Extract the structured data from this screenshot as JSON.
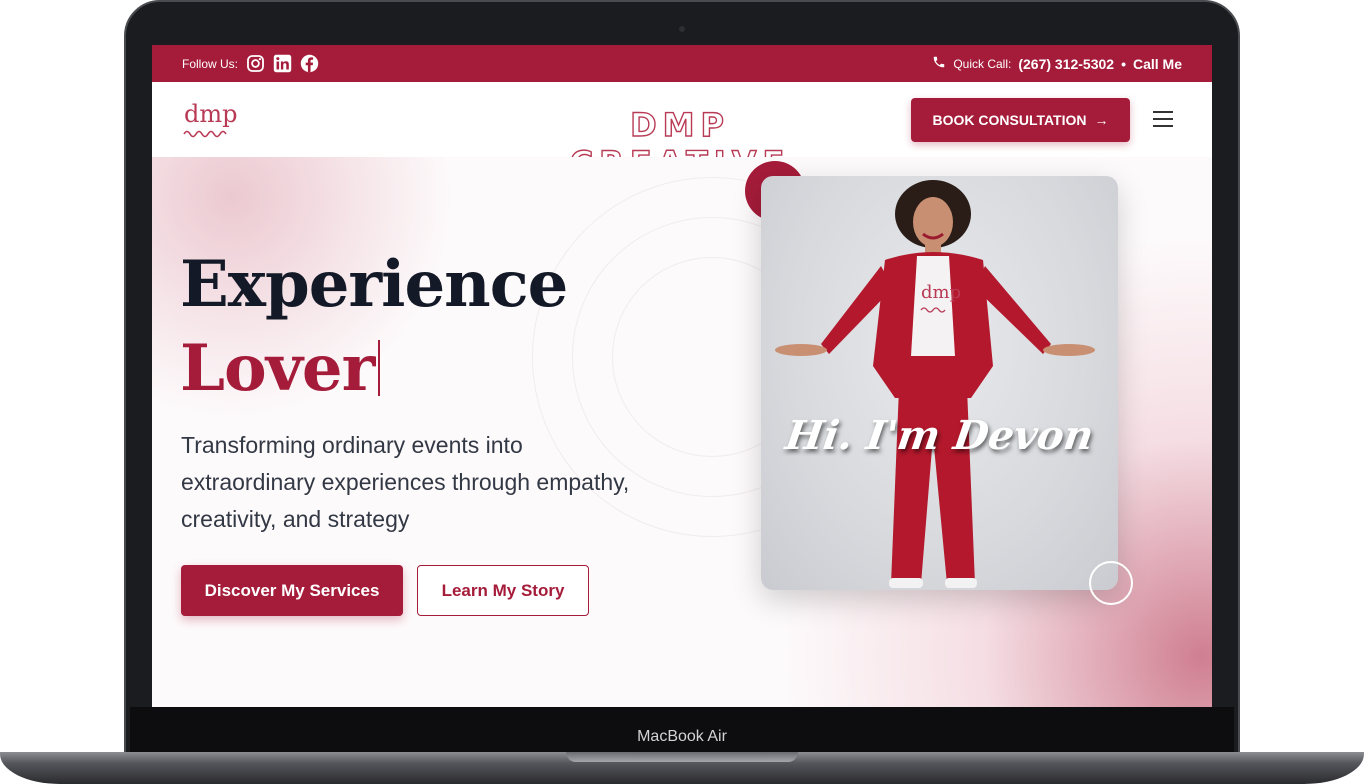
{
  "topbar": {
    "follow_label": "Follow Us:",
    "social_icons": [
      "instagram-icon",
      "linkedin-icon",
      "facebook-icon"
    ],
    "quick_call_label": "Quick Call:",
    "phone": "(267) 312-5302",
    "separator": "•",
    "call_me": "Call Me"
  },
  "header": {
    "logo_text": "dmp",
    "brand": "DMP CREATIVE",
    "book_label": "BOOK CONSULTATION",
    "book_arrow": "→"
  },
  "hero": {
    "headline_1": "Experience",
    "headline_2": "Lover",
    "subtext": "Transforming ordinary events into extraordinary experiences through empathy, creativity, and strategy",
    "primary_button": "Discover My Services",
    "secondary_button": "Learn My Story",
    "photo_caption": "Hi. I'm Devon"
  },
  "device": {
    "model_label": "MacBook Air"
  },
  "colors": {
    "brand_red": "#a51c3a",
    "headline_dark": "#141927",
    "body_text": "#333845"
  }
}
